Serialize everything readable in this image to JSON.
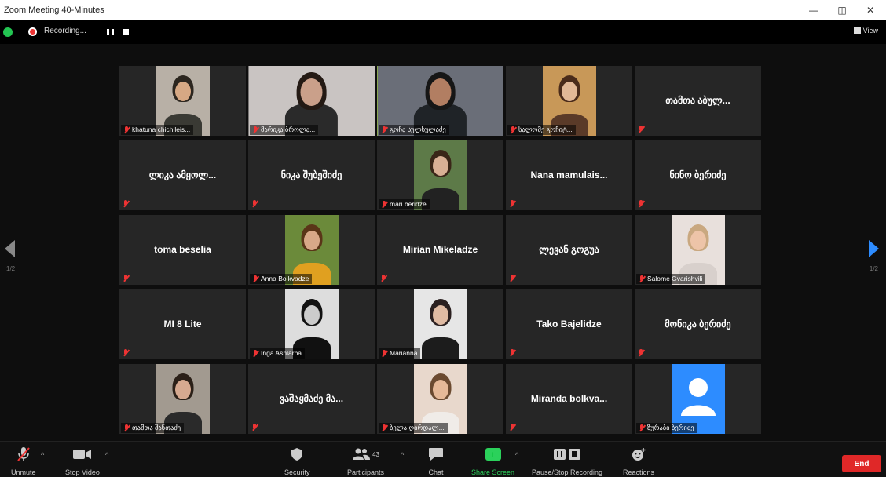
{
  "window": {
    "title": "Zoom Meeting 40-Minutes",
    "minimize": "—",
    "restore": "◫",
    "close": "✕"
  },
  "topbar": {
    "recording_label": "Recording...",
    "view_label": "View"
  },
  "pagination": {
    "left": "1/2",
    "right": "1/2"
  },
  "participants": [
    {
      "name": "khatuna chichileis...",
      "video": true,
      "big": false
    },
    {
      "name": "მარიკა ბროლა...",
      "video": true,
      "big": false
    },
    {
      "name": "გოჩა სულხულაძე",
      "video": true,
      "big": false,
      "active": true
    },
    {
      "name": "სალომე გოჩიტ...",
      "video": true,
      "big": false
    },
    {
      "name": "თამთა აბულ...",
      "video": false,
      "big": true
    },
    {
      "name": "ლიკა ამყოლ...",
      "video": false,
      "big": true
    },
    {
      "name": "ნიკა შუბეშიძე",
      "video": false,
      "big": true
    },
    {
      "name": "mari beridze",
      "video": true,
      "big": false
    },
    {
      "name": "Nana mamulais...",
      "video": false,
      "big": true
    },
    {
      "name": "ნინო ბერიძე",
      "video": false,
      "big": true
    },
    {
      "name": "toma beselia",
      "video": false,
      "big": true
    },
    {
      "name": "Anna Bolkvadze",
      "video": true,
      "big": false
    },
    {
      "name": "Mirian Mikeladze",
      "video": false,
      "big": true
    },
    {
      "name": "ლევან გოგუა",
      "video": false,
      "big": true
    },
    {
      "name": "Salome Gvarishvili",
      "video": true,
      "big": false
    },
    {
      "name": "MI 8 Lite",
      "video": false,
      "big": true
    },
    {
      "name": "Inga Ashlarba",
      "video": true,
      "big": false
    },
    {
      "name": "Marianna",
      "video": true,
      "big": false
    },
    {
      "name": "Tako Bajelidze",
      "video": false,
      "big": true
    },
    {
      "name": "მონიკა ბერიძე",
      "video": false,
      "big": true
    },
    {
      "name": "თამთა შანთაძე",
      "video": true,
      "big": false
    },
    {
      "name": "ვაშაყმაძე მა...",
      "video": false,
      "big": true
    },
    {
      "name": "ბელა ღირდალ...",
      "video": true,
      "big": false
    },
    {
      "name": "Miranda bolkva...",
      "video": false,
      "big": true
    },
    {
      "name": "ზურაბი ბერიძე",
      "video": true,
      "big": false,
      "avatar": true
    }
  ],
  "toolbar": {
    "unmute": "Unmute",
    "stop_video": "Stop Video",
    "security": "Security",
    "participants": "Participants",
    "participants_count": "43",
    "chat": "Chat",
    "share_screen": "Share Screen",
    "pause_stop_recording": "Pause/Stop Recording",
    "reactions": "Reactions",
    "end": "End"
  },
  "colors": {
    "active_speaker": "#a8e02a",
    "share_green": "#2bd15b",
    "end_red": "#e02828",
    "nav_blue": "#2d8cff"
  }
}
